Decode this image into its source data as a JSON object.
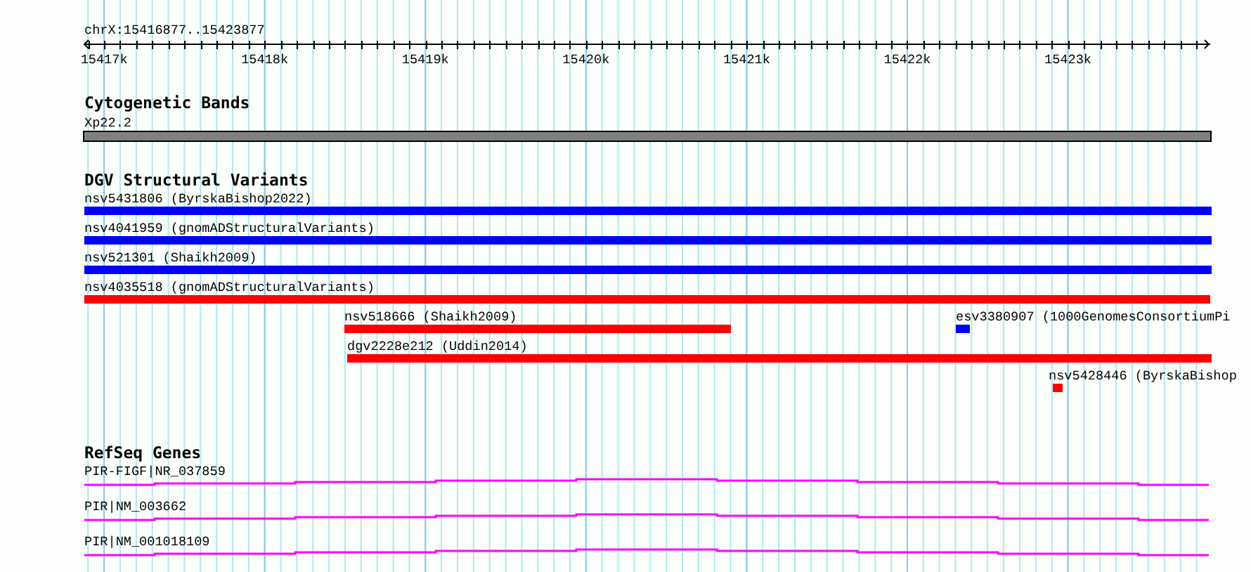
{
  "location": "chrX:15416877..15423877",
  "ruler": {
    "ticks": [
      "15417k",
      "15418k",
      "15419k",
      "15420k",
      "15421k",
      "15422k",
      "15423k"
    ]
  },
  "tracks": [
    {
      "kind": "cytoband",
      "title": "Cytogenetic Bands",
      "features": [
        {
          "label": "Xp22.2"
        }
      ]
    },
    {
      "kind": "variants",
      "title": "DGV Structural Variants",
      "features": [
        {
          "label": "nsv5431806 (ByrskaBishop2022)",
          "color": "#0000ff"
        },
        {
          "label": "nsv4041959 (gnomADStructuralVariants)",
          "color": "#0000ff"
        },
        {
          "label": "nsv521301 (Shaikh2009)",
          "color": "#0000ff"
        },
        {
          "label": "nsv4035518 (gnomADStructuralVariants)",
          "color": "#ff0000"
        },
        {
          "label": "nsv518666 (Shaikh2009)",
          "color": "#ff0000"
        },
        {
          "label": "esv3380907 (1000GenomesConsortiumPi",
          "color": "#0000ff"
        },
        {
          "label": "dgv2228e212 (Uddin2014)",
          "color": "#ff0000"
        },
        {
          "label": "nsv5428446 (ByrskaBishop",
          "color": "#ff0000"
        }
      ]
    },
    {
      "kind": "genes",
      "title": "RefSeq Genes",
      "features": [
        {
          "label": "PIR-FIGF|NR_037859"
        },
        {
          "label": "PIR|NM_003662"
        },
        {
          "label": "PIR|NM_001018109"
        }
      ]
    }
  ]
}
